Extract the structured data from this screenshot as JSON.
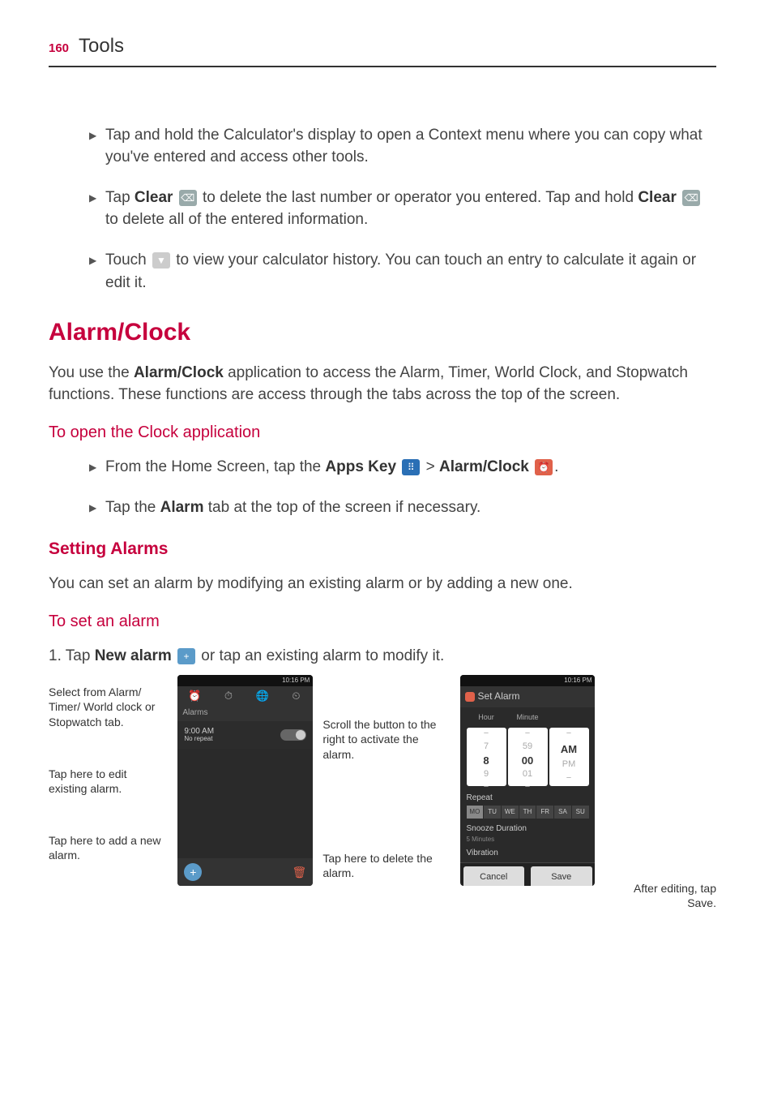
{
  "header": {
    "page_number": "160",
    "title": "Tools"
  },
  "bullets": {
    "b1": "Tap and hold the Calculator's display to open a Context menu where you can copy what you've entered and access other tools.",
    "b2a": "Tap ",
    "b2b": "Clear",
    "b2c": " to delete the last number or operator you entered. Tap and hold ",
    "b2d": "Clear",
    "b2e": " to delete all of the entered information.",
    "b3a": "Touch ",
    "b3b": " to view your calculator history. You can touch an entry to calculate it again or edit it."
  },
  "section_alarm": {
    "heading": "Alarm/Clock",
    "intro_a": "You use the ",
    "intro_b": "Alarm/Clock",
    "intro_c": " application to access the Alarm, Timer, World Clock, and Stopwatch functions. These functions are access through the tabs across the top of the screen.",
    "open_heading": "To open the Clock application",
    "open_1a": "From the Home Screen, tap the ",
    "open_1b": "Apps Key",
    "open_1c": " > ",
    "open_1d": "Alarm/Clock",
    "open_1e": ".",
    "open_2a": "Tap the ",
    "open_2b": "Alarm",
    "open_2c": " tab at the top of the screen if necessary."
  },
  "section_set": {
    "heading": "Setting Alarms",
    "intro": "You can set an alarm by modifying an existing alarm or by adding a new one.",
    "sub": "To set an alarm",
    "step_a": "1.  Tap ",
    "step_b": "New alarm",
    "step_c": " or tap an existing alarm to modify it."
  },
  "fig": {
    "left_labels": {
      "l1": "Select from Alarm/ Timer/ World clock or Stopwatch tab.",
      "l2": "Tap here to edit existing alarm.",
      "l3": "Tap here to add a new alarm."
    },
    "mid_labels": {
      "m1": "Scroll the button to the right to activate the alarm.",
      "m2": "Tap here to delete the alarm."
    },
    "right_label": "After editing, tap Save.",
    "right_label_b": "Save",
    "phone1": {
      "status_time": "10:16 PM",
      "tabs": [
        "⏰",
        "⏱",
        "🌐",
        "⏲"
      ],
      "subheader": "Alarms",
      "alarm_time": "9:00 AM",
      "alarm_sub": "No repeat",
      "add": "+",
      "trash": "🗑"
    },
    "phone2": {
      "status_time": "10:16 PM",
      "title": "Set Alarm",
      "cols": [
        "Hour",
        "Minute",
        ""
      ],
      "wheel_h": [
        "−",
        "7",
        "8",
        "9",
        "−"
      ],
      "wheel_m": [
        "−",
        "59",
        "00",
        "01",
        "−"
      ],
      "wheel_a": [
        "−",
        "",
        "AM",
        "PM",
        "−"
      ],
      "repeat": "Repeat",
      "days": [
        "MO",
        "TU",
        "WE",
        "TH",
        "FR",
        "SA",
        "SU"
      ],
      "snooze_h": "Snooze Duration",
      "snooze_v": "5 Minutes",
      "vibration": "Vibration",
      "cancel": "Cancel",
      "save": "Save"
    }
  }
}
